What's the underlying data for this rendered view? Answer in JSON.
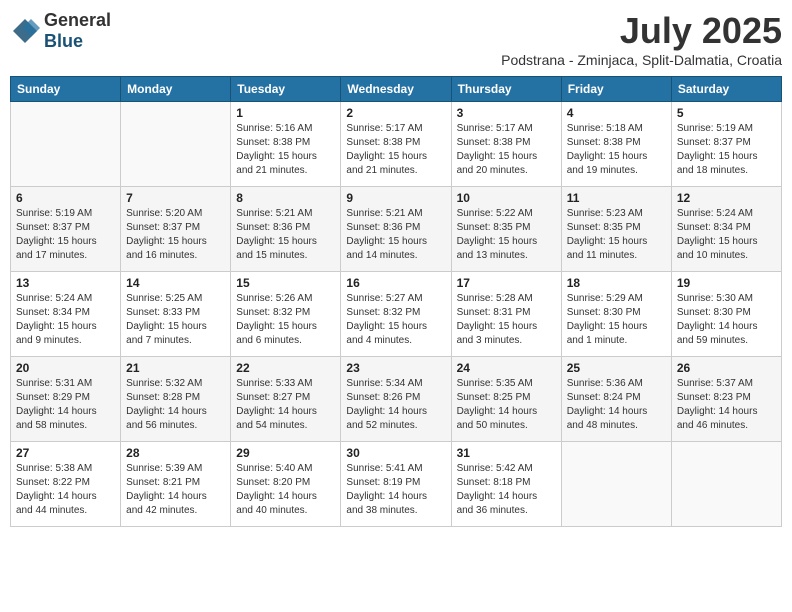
{
  "header": {
    "logo_general": "General",
    "logo_blue": "Blue",
    "month_year": "July 2025",
    "location": "Podstrana - Zminjaca, Split-Dalmatia, Croatia"
  },
  "weekdays": [
    "Sunday",
    "Monday",
    "Tuesday",
    "Wednesday",
    "Thursday",
    "Friday",
    "Saturday"
  ],
  "weeks": [
    [
      {
        "day": "",
        "info": ""
      },
      {
        "day": "",
        "info": ""
      },
      {
        "day": "1",
        "info": "Sunrise: 5:16 AM\nSunset: 8:38 PM\nDaylight: 15 hours\nand 21 minutes."
      },
      {
        "day": "2",
        "info": "Sunrise: 5:17 AM\nSunset: 8:38 PM\nDaylight: 15 hours\nand 21 minutes."
      },
      {
        "day": "3",
        "info": "Sunrise: 5:17 AM\nSunset: 8:38 PM\nDaylight: 15 hours\nand 20 minutes."
      },
      {
        "day": "4",
        "info": "Sunrise: 5:18 AM\nSunset: 8:38 PM\nDaylight: 15 hours\nand 19 minutes."
      },
      {
        "day": "5",
        "info": "Sunrise: 5:19 AM\nSunset: 8:37 PM\nDaylight: 15 hours\nand 18 minutes."
      }
    ],
    [
      {
        "day": "6",
        "info": "Sunrise: 5:19 AM\nSunset: 8:37 PM\nDaylight: 15 hours\nand 17 minutes."
      },
      {
        "day": "7",
        "info": "Sunrise: 5:20 AM\nSunset: 8:37 PM\nDaylight: 15 hours\nand 16 minutes."
      },
      {
        "day": "8",
        "info": "Sunrise: 5:21 AM\nSunset: 8:36 PM\nDaylight: 15 hours\nand 15 minutes."
      },
      {
        "day": "9",
        "info": "Sunrise: 5:21 AM\nSunset: 8:36 PM\nDaylight: 15 hours\nand 14 minutes."
      },
      {
        "day": "10",
        "info": "Sunrise: 5:22 AM\nSunset: 8:35 PM\nDaylight: 15 hours\nand 13 minutes."
      },
      {
        "day": "11",
        "info": "Sunrise: 5:23 AM\nSunset: 8:35 PM\nDaylight: 15 hours\nand 11 minutes."
      },
      {
        "day": "12",
        "info": "Sunrise: 5:24 AM\nSunset: 8:34 PM\nDaylight: 15 hours\nand 10 minutes."
      }
    ],
    [
      {
        "day": "13",
        "info": "Sunrise: 5:24 AM\nSunset: 8:34 PM\nDaylight: 15 hours\nand 9 minutes."
      },
      {
        "day": "14",
        "info": "Sunrise: 5:25 AM\nSunset: 8:33 PM\nDaylight: 15 hours\nand 7 minutes."
      },
      {
        "day": "15",
        "info": "Sunrise: 5:26 AM\nSunset: 8:32 PM\nDaylight: 15 hours\nand 6 minutes."
      },
      {
        "day": "16",
        "info": "Sunrise: 5:27 AM\nSunset: 8:32 PM\nDaylight: 15 hours\nand 4 minutes."
      },
      {
        "day": "17",
        "info": "Sunrise: 5:28 AM\nSunset: 8:31 PM\nDaylight: 15 hours\nand 3 minutes."
      },
      {
        "day": "18",
        "info": "Sunrise: 5:29 AM\nSunset: 8:30 PM\nDaylight: 15 hours\nand 1 minute."
      },
      {
        "day": "19",
        "info": "Sunrise: 5:30 AM\nSunset: 8:30 PM\nDaylight: 14 hours\nand 59 minutes."
      }
    ],
    [
      {
        "day": "20",
        "info": "Sunrise: 5:31 AM\nSunset: 8:29 PM\nDaylight: 14 hours\nand 58 minutes."
      },
      {
        "day": "21",
        "info": "Sunrise: 5:32 AM\nSunset: 8:28 PM\nDaylight: 14 hours\nand 56 minutes."
      },
      {
        "day": "22",
        "info": "Sunrise: 5:33 AM\nSunset: 8:27 PM\nDaylight: 14 hours\nand 54 minutes."
      },
      {
        "day": "23",
        "info": "Sunrise: 5:34 AM\nSunset: 8:26 PM\nDaylight: 14 hours\nand 52 minutes."
      },
      {
        "day": "24",
        "info": "Sunrise: 5:35 AM\nSunset: 8:25 PM\nDaylight: 14 hours\nand 50 minutes."
      },
      {
        "day": "25",
        "info": "Sunrise: 5:36 AM\nSunset: 8:24 PM\nDaylight: 14 hours\nand 48 minutes."
      },
      {
        "day": "26",
        "info": "Sunrise: 5:37 AM\nSunset: 8:23 PM\nDaylight: 14 hours\nand 46 minutes."
      }
    ],
    [
      {
        "day": "27",
        "info": "Sunrise: 5:38 AM\nSunset: 8:22 PM\nDaylight: 14 hours\nand 44 minutes."
      },
      {
        "day": "28",
        "info": "Sunrise: 5:39 AM\nSunset: 8:21 PM\nDaylight: 14 hours\nand 42 minutes."
      },
      {
        "day": "29",
        "info": "Sunrise: 5:40 AM\nSunset: 8:20 PM\nDaylight: 14 hours\nand 40 minutes."
      },
      {
        "day": "30",
        "info": "Sunrise: 5:41 AM\nSunset: 8:19 PM\nDaylight: 14 hours\nand 38 minutes."
      },
      {
        "day": "31",
        "info": "Sunrise: 5:42 AM\nSunset: 8:18 PM\nDaylight: 14 hours\nand 36 minutes."
      },
      {
        "day": "",
        "info": ""
      },
      {
        "day": "",
        "info": ""
      }
    ]
  ]
}
